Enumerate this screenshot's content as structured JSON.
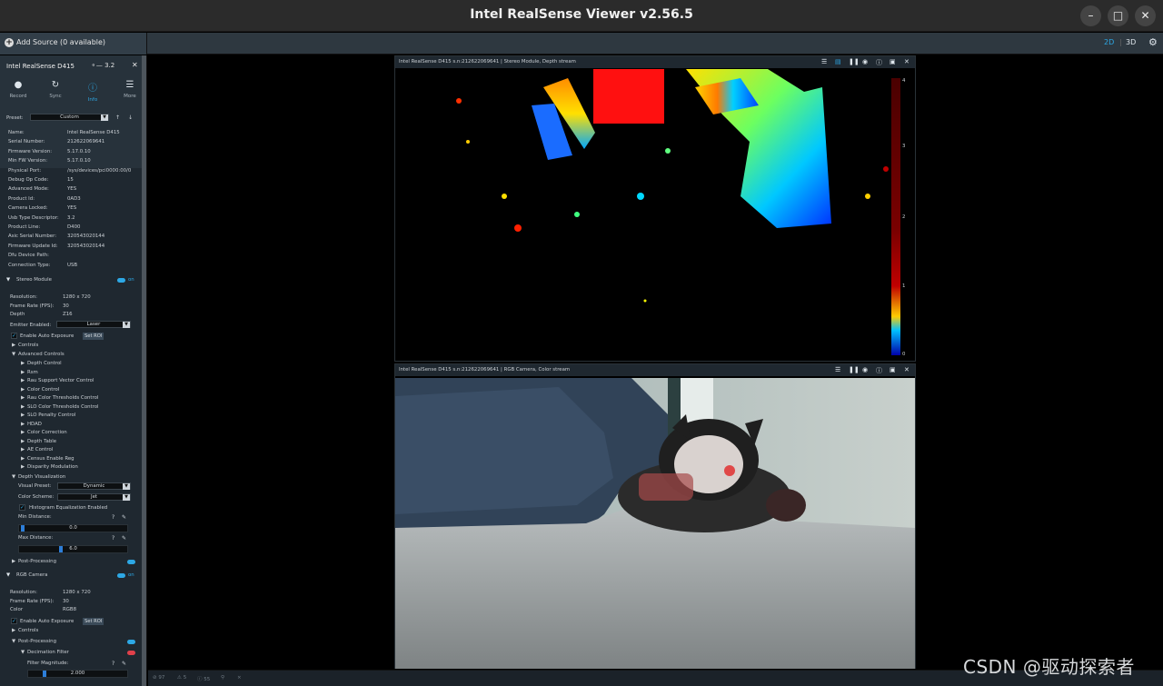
{
  "window": {
    "title": "Intel RealSense Viewer v2.56.5"
  },
  "topbar": {
    "add_source": "Add Source (0 available)",
    "mode_2d": "2D",
    "mode_3d": "3D"
  },
  "device": {
    "name": "Intel RealSense D415",
    "usb": "3.2",
    "toolbar": [
      {
        "label": "Record",
        "icon": "record-icon"
      },
      {
        "label": "Sync",
        "icon": "sync-icon"
      },
      {
        "label": "Info",
        "icon": "info-icon"
      },
      {
        "label": "More",
        "icon": "more-icon"
      }
    ],
    "preset_label": "Preset:",
    "preset_value": "Custom",
    "info_rows": [
      {
        "k": "Name:",
        "v": "Intel RealSense D415"
      },
      {
        "k": "Serial Number:",
        "v": "212622069641"
      },
      {
        "k": "Firmware Version:",
        "v": "5.17.0.10"
      },
      {
        "k": "Min FW Version:",
        "v": "5.17.0.10"
      },
      {
        "k": "Physical Port:",
        "v": "/sys/devices/pci0000:00/0"
      },
      {
        "k": "Debug Op Code:",
        "v": "15"
      },
      {
        "k": "Advanced Mode:",
        "v": "YES"
      },
      {
        "k": "Product Id:",
        "v": "0AD3"
      },
      {
        "k": "Camera Locked:",
        "v": "YES"
      },
      {
        "k": "Usb Type Descriptor:",
        "v": "3.2"
      },
      {
        "k": "Product Line:",
        "v": "D400"
      },
      {
        "k": "Asic Serial Number:",
        "v": "320543020144"
      },
      {
        "k": "Firmware Update Id:",
        "v": "320543020144"
      },
      {
        "k": "Dfu Device Path:",
        "v": ""
      },
      {
        "k": "Connection Type:",
        "v": "USB"
      }
    ]
  },
  "stereo": {
    "title": "Stereo Module",
    "on": "on",
    "resolution_k": "Resolution:",
    "resolution_v": "1280 x 720",
    "fps_k": "Frame Rate (FPS):",
    "fps_v": "30",
    "depth_k": "Depth",
    "depth_v": "Z16",
    "emitter_k": "Emitter Enabled:",
    "emitter_v": "Laser",
    "auto_exposure": "Enable Auto Exposure",
    "set_roi": "Set ROI",
    "controls": "Controls",
    "advanced": "Advanced Controls",
    "adv_items": [
      "Depth Control",
      "Rsm",
      "Rau Support Vector Control",
      "Color Control",
      "Rau Color Thresholds Control",
      "SLO Color Thresholds Control",
      "SLO Penalty Control",
      "HDAD",
      "Color Correction",
      "Depth Table",
      "AE Control",
      "Census Enable Reg",
      "Disparity Modulation"
    ],
    "depth_vis": "Depth Visualization",
    "visual_preset_k": "Visual Preset:",
    "visual_preset_v": "Dynamic",
    "color_scheme_k": "Color Scheme:",
    "color_scheme_v": "Jet",
    "histogram": "Histogram Equalization Enabled",
    "min_dist_k": "Min Distance:",
    "min_dist_v": "0.0",
    "max_dist_k": "Max Distance:",
    "max_dist_v": "6.0",
    "post": "Post-Processing"
  },
  "rgb": {
    "title": "RGB Camera",
    "on": "on",
    "resolution_k": "Resolution:",
    "resolution_v": "1280 x 720",
    "fps_k": "Frame Rate (FPS):",
    "fps_v": "30",
    "color_k": "Color",
    "color_v": "RGB8",
    "auto_exposure": "Enable Auto Exposure",
    "set_roi": "Set ROI",
    "controls": "Controls",
    "post": "Post-Processing",
    "decimation": "Decimation Filter",
    "filter_mag_k": "Filter Magnitude:",
    "filter_mag_v": "2.000"
  },
  "depth_pane": {
    "header": "Intel RealSense D415 s.n:212622069641 | Stereo Module, Depth stream",
    "scale": [
      "4",
      "3",
      "2",
      "1",
      "0"
    ]
  },
  "color_pane": {
    "header": "Intel RealSense D415 s.n:212622069641 | RGB Camera, Color stream"
  },
  "status": {
    "errors": "97",
    "warnings": "5",
    "info": "55"
  },
  "watermark": "CSDN @驱动探索者"
}
